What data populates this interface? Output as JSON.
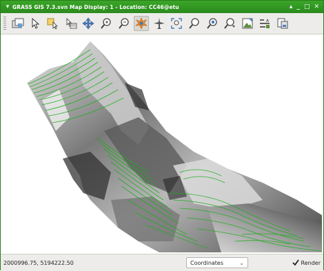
{
  "window": {
    "title": "GRASS GIS 7.3.svn Map Display: 1 - Location: CC46@etu",
    "controls": [
      "▴",
      "_",
      "□",
      "✕"
    ]
  },
  "toolbar": {
    "tools": [
      {
        "name": "add-map-layers-icon"
      },
      {
        "name": "pointer-icon"
      },
      {
        "name": "select-icon"
      },
      {
        "name": "query-icon"
      },
      {
        "name": "pan-icon"
      },
      {
        "name": "zoom-in-icon"
      },
      {
        "name": "zoom-out-icon"
      },
      {
        "name": "3d-view-icon",
        "active": true
      },
      {
        "name": "fly-icon"
      },
      {
        "name": "zoom-extent-icon"
      },
      {
        "name": "zoom-back-icon"
      },
      {
        "name": "zoom-region-icon"
      },
      {
        "name": "zoom-options-icon"
      },
      {
        "name": "save-image-icon"
      },
      {
        "name": "decorations-icon"
      },
      {
        "name": "analyze-icon"
      }
    ]
  },
  "status": {
    "coordinates": "2000996.75, 5194222.50",
    "mode_select": "Coordinates",
    "render_label": "Render",
    "render_checked": true
  },
  "colors": {
    "titlebar": "#2b8a1d",
    "contour": "#1fae1f"
  }
}
